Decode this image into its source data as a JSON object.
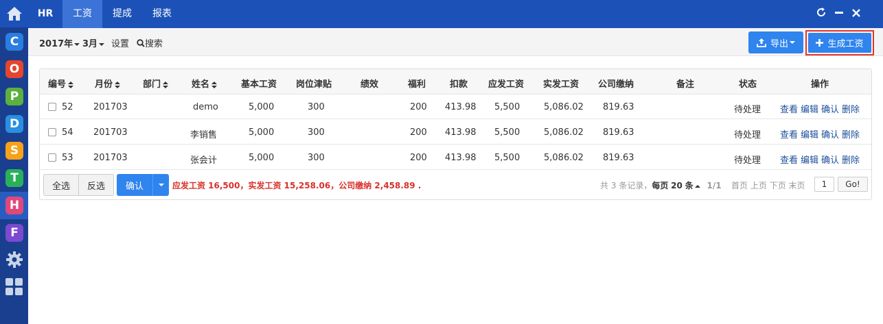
{
  "topbar": {
    "nav": [
      {
        "label": "HR"
      },
      {
        "label": "工资"
      },
      {
        "label": "提成"
      },
      {
        "label": "报表"
      }
    ],
    "window_buttons": [
      "refresh-icon",
      "minimize-icon",
      "close-icon"
    ]
  },
  "sidebar": {
    "apps": [
      {
        "letter": "C",
        "color": "#2a7de1"
      },
      {
        "letter": "O",
        "color": "#e5452f"
      },
      {
        "letter": "P",
        "color": "#5bb040"
      },
      {
        "letter": "D",
        "color": "#2a8fe1"
      },
      {
        "letter": "S",
        "color": "#f5a21a"
      },
      {
        "letter": "T",
        "color": "#2bb05a"
      },
      {
        "letter": "H",
        "color": "#e0487a"
      },
      {
        "letter": "F",
        "color": "#7b4ad0"
      }
    ]
  },
  "toolbar": {
    "year": "2017年",
    "month": "3月",
    "settings": "设置",
    "search": "搜索",
    "export": "导出",
    "generate": "生成工资"
  },
  "table": {
    "headers": [
      "编号",
      "月份",
      "部门",
      "姓名",
      "基本工资",
      "岗位津贴",
      "绩效",
      "福利",
      "扣款",
      "应发工资",
      "实发工资",
      "公司缴纳",
      "备注",
      "状态",
      "操作"
    ],
    "rows": [
      {
        "id": "52",
        "month": "201703",
        "dept": "",
        "name": "demo",
        "base": "5,000",
        "allowance": "300",
        "perf": "",
        "welfare": "200",
        "deduction": "413.98",
        "gross": "5,500",
        "net": "5,086.02",
        "company": "819.63",
        "remark": "",
        "status": "待处理"
      },
      {
        "id": "54",
        "month": "201703",
        "dept": "",
        "name": "李销售",
        "base": "5,000",
        "allowance": "300",
        "perf": "",
        "welfare": "200",
        "deduction": "413.98",
        "gross": "5,500",
        "net": "5,086.02",
        "company": "819.63",
        "remark": "",
        "status": "待处理"
      },
      {
        "id": "53",
        "month": "201703",
        "dept": "",
        "name": "张会计",
        "base": "5,000",
        "allowance": "300",
        "perf": "",
        "welfare": "200",
        "deduction": "413.98",
        "gross": "5,500",
        "net": "5,086.02",
        "company": "819.63",
        "remark": "",
        "status": "待处理"
      }
    ],
    "actions": [
      "查看",
      "编辑",
      "确认",
      "删除"
    ]
  },
  "footer": {
    "select_all": "全选",
    "invert": "反选",
    "confirm": "确认",
    "summary": "应发工资 16,500，实发工资 15,258.06，公司缴纳 2,458.89 .",
    "record_prefix": "共",
    "record_count": "3",
    "record_suffix": "条记录，",
    "per_page_prefix": "每页",
    "per_page": "20",
    "per_page_suffix": "条",
    "page_info": "1/1",
    "first": "首页",
    "prev": "上页",
    "next": "下页",
    "last": "末页",
    "page_value": "1",
    "go": "Go!"
  }
}
